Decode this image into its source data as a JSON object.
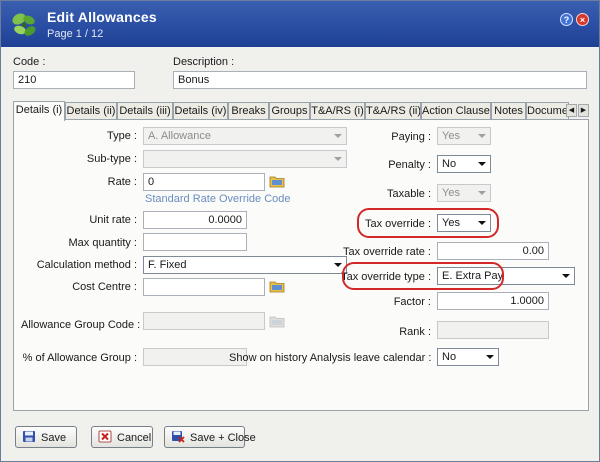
{
  "window": {
    "title": "Edit Allowances",
    "subtitle": "Page 1 / 12",
    "help_label": "?",
    "close_label": "×"
  },
  "header": {
    "code_label": "Code :",
    "code_value": "210",
    "description_label": "Description :",
    "description_value": "Bonus"
  },
  "tabs": [
    {
      "label": "Details (i)"
    },
    {
      "label": "Details (ii)"
    },
    {
      "label": "Details (iii)"
    },
    {
      "label": "Details (iv)"
    },
    {
      "label": "Breaks"
    },
    {
      "label": "Groups"
    },
    {
      "label": "T&A/RS (i)"
    },
    {
      "label": "T&A/RS (ii)"
    },
    {
      "label": "Action Clauses"
    },
    {
      "label": "Notes"
    },
    {
      "label": "Documer"
    }
  ],
  "tab_scroll": {
    "left": "◀",
    "right": "▶"
  },
  "left": {
    "type_label": "Type :",
    "type_value": "A. Allowance",
    "subtype_label": "Sub-type :",
    "subtype_value": "",
    "rate_label": "Rate :",
    "rate_value": "0",
    "rate_link": "Standard Rate Override Code",
    "unit_rate_label": "Unit rate :",
    "unit_rate_value": "0.0000",
    "max_quantity_label": "Max quantity :",
    "max_quantity_value": "",
    "calc_method_label": "Calculation method :",
    "calc_method_value": "F. Fixed",
    "cost_centre_label": "Cost Centre :",
    "cost_centre_value": "",
    "allowance_group_code_label": "Allowance Group Code :",
    "allowance_group_code_value": "",
    "pct_allowance_group_label": "% of Allowance Group :",
    "pct_allowance_group_value": ""
  },
  "right": {
    "paying_label": "Paying :",
    "paying_value": "Yes",
    "penalty_label": "Penalty :",
    "penalty_value": "No",
    "taxable_label": "Taxable :",
    "taxable_value": "Yes",
    "tax_override_label": "Tax override :",
    "tax_override_value": "Yes",
    "tax_override_rate_label": "Tax override rate :",
    "tax_override_rate_value": "0.00",
    "tax_override_type_label": "Tax override type :",
    "tax_override_type_value": "E. Extra Pay",
    "factor_label": "Factor :",
    "factor_value": "1.0000",
    "rank_label": "Rank :",
    "rank_value": "",
    "show_history_label": "Show on history Analysis leave calendar :",
    "show_history_value": "No"
  },
  "buttons": {
    "save_label": "Save",
    "cancel_label": "Cancel",
    "save_close_label": "Save + Close"
  },
  "colors": {
    "titlebar": "#2a4ea3",
    "highlight_ring": "#d42828",
    "link": "#6a8dc0"
  }
}
